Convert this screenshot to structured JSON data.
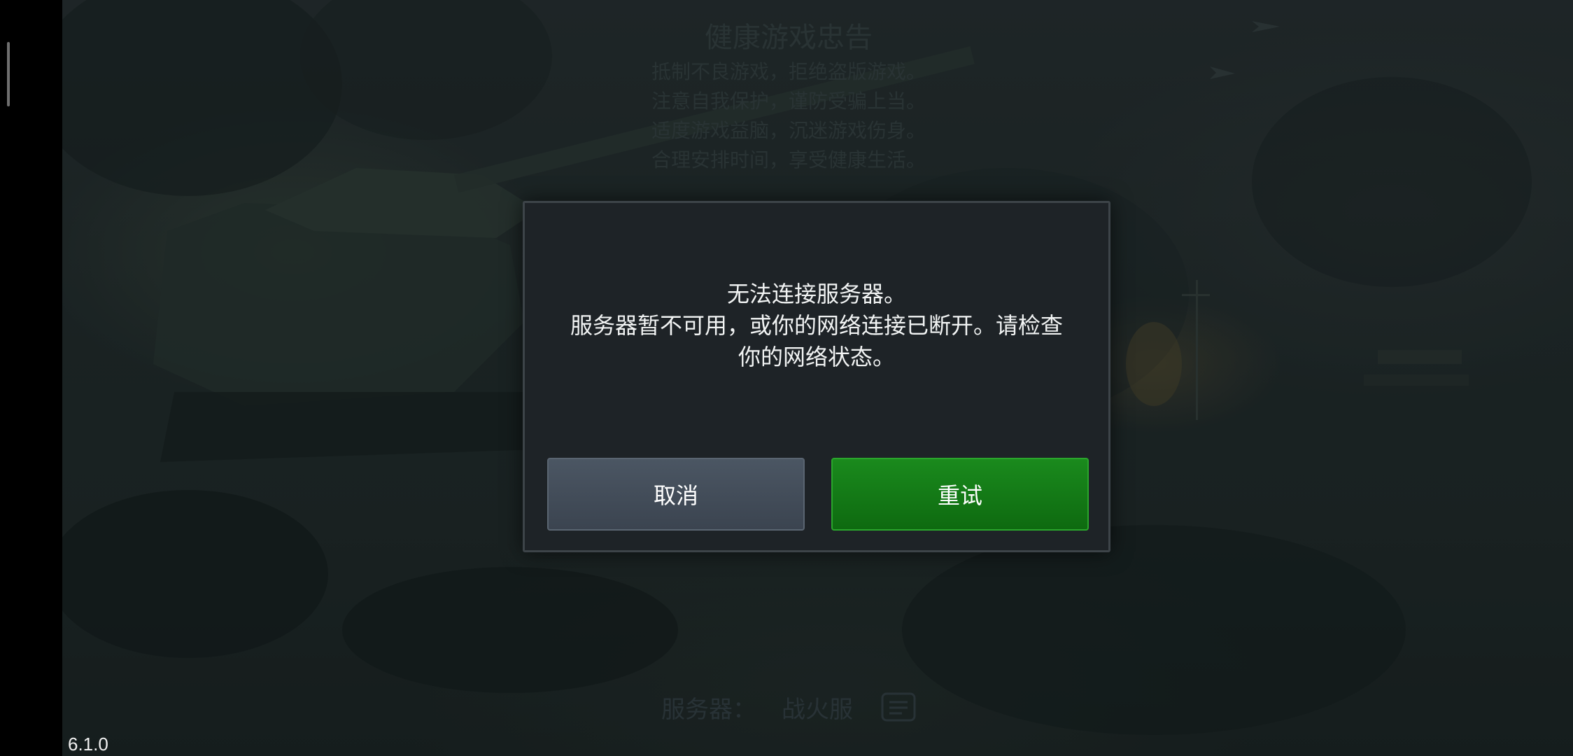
{
  "health_notice": {
    "title": "健康游戏忠告",
    "lines": [
      "抵制不良游戏，拒绝盗版游戏。",
      "注意自我保护，谨防受骗上当。",
      "适度游戏益脑，沉迷游戏伤身。",
      "合理安排时间，享受健康生活。"
    ]
  },
  "dialog": {
    "line1": "无法连接服务器。",
    "line2": "服务器暂不可用，或你的网络连接已断开。请检查",
    "line3": "你的网络状态。",
    "cancel_label": "取消",
    "retry_label": "重试"
  },
  "server": {
    "label": "服务器：",
    "name": "战火服",
    "icon": "server-select-icon"
  },
  "version": "6.1.0",
  "colors": {
    "dialog_bg": "#1e2327",
    "retry_green": "#138016",
    "cancel_gray": "#434d59"
  }
}
